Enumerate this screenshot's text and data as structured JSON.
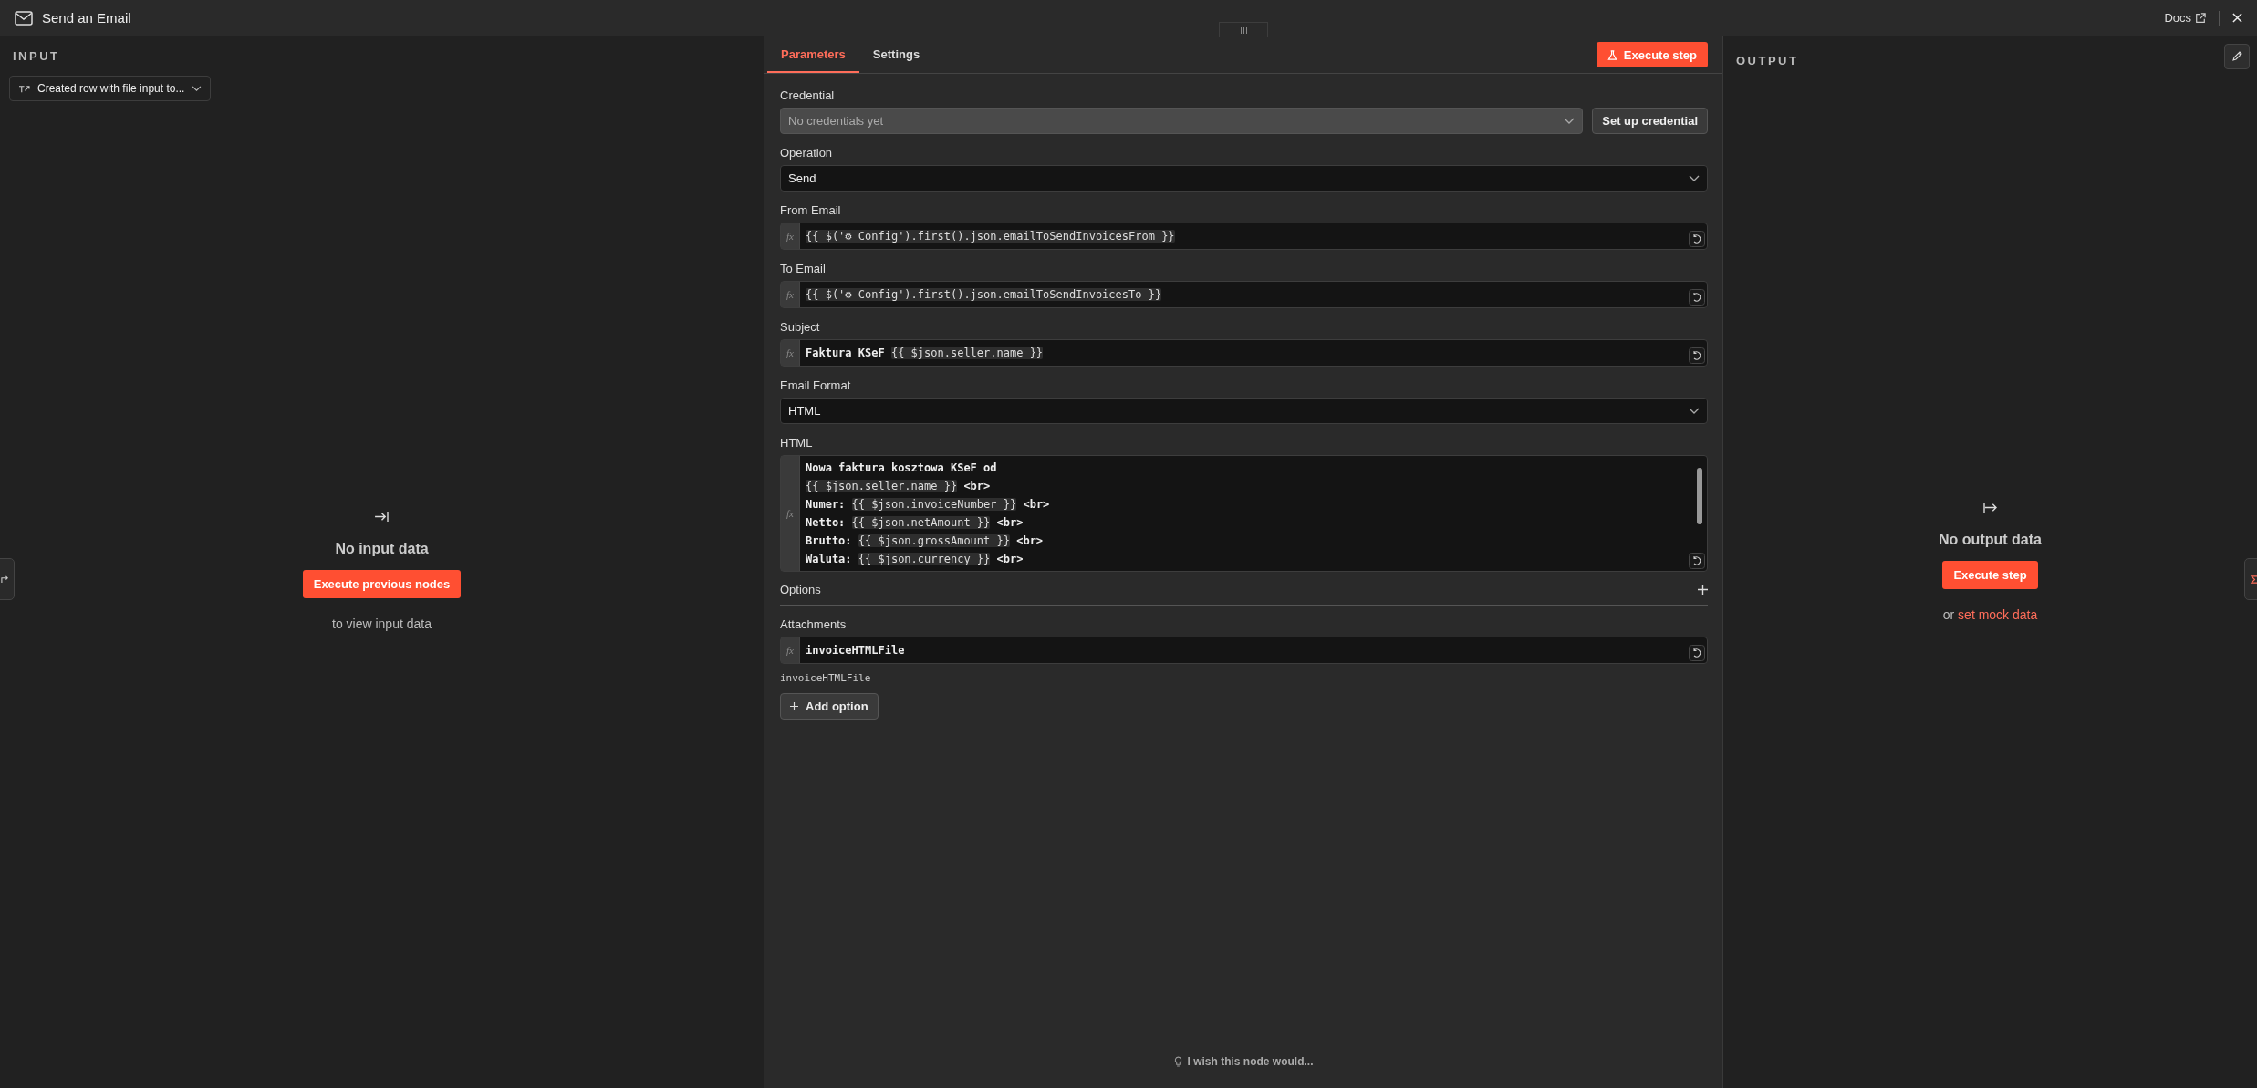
{
  "header": {
    "title": "Send an Email",
    "docs_link": "Docs"
  },
  "input_panel": {
    "title": "INPUT",
    "source_select": "Created row with file input to...",
    "empty_title": "No input data",
    "button": "Execute previous nodes",
    "hint": "to view input data"
  },
  "tabs": [
    {
      "label": "Parameters",
      "selected": true
    },
    {
      "label": "Settings",
      "selected": false
    }
  ],
  "execute_button": "Execute step",
  "fields": [
    {
      "kind": "select",
      "label": "Credential",
      "placeholder": "No credentials yet",
      "disabled": true,
      "action": "Set up credential"
    },
    {
      "kind": "select",
      "label": "Operation",
      "value": "Send",
      "disabled": false
    },
    {
      "kind": "expression",
      "label": "From Email",
      "badge": "fx",
      "segments": [
        {
          "highlighted": true,
          "text": "{{ $('⚙ Config').first().json.emailToSendInvoicesFrom }}"
        }
      ]
    },
    {
      "kind": "expression",
      "label": "To Email",
      "badge": "fx",
      "segments": [
        {
          "highlighted": true,
          "text": "{{ $('⚙ Config').first().json.emailToSendInvoicesTo }}"
        }
      ]
    },
    {
      "kind": "expression",
      "label": "Subject",
      "badge": "fx",
      "segments": [
        {
          "highlighted": false,
          "text": "Faktura KSeF "
        },
        {
          "highlighted": true,
          "text": "{{ $json.seller.name }}"
        }
      ]
    },
    {
      "kind": "select",
      "label": "Email Format",
      "value": "HTML",
      "disabled": false
    },
    {
      "kind": "code",
      "label": "HTML",
      "badge": "fx",
      "lines": [
        [
          {
            "highlighted": false,
            "text": "Nowa faktura kosztowa KSeF od"
          }
        ],
        [
          {
            "highlighted": true,
            "text": "{{ $json.seller.name }}"
          },
          {
            "highlighted": false,
            "text": " <br>"
          }
        ],
        [
          {
            "highlighted": false,
            "text": "Numer: "
          },
          {
            "highlighted": true,
            "text": "{{ $json.invoiceNumber }}"
          },
          {
            "highlighted": false,
            "text": " <br>"
          }
        ],
        [
          {
            "highlighted": false,
            "text": "Netto: "
          },
          {
            "highlighted": true,
            "text": "{{ $json.netAmount }}"
          },
          {
            "highlighted": false,
            "text": " <br>"
          }
        ],
        [
          {
            "highlighted": false,
            "text": "Brutto: "
          },
          {
            "highlighted": true,
            "text": "{{ $json.grossAmount }}"
          },
          {
            "highlighted": false,
            "text": " <br>"
          }
        ],
        [
          {
            "highlighted": false,
            "text": "Waluta: "
          },
          {
            "highlighted": true,
            "text": "{{ $json.currency }}"
          },
          {
            "highlighted": false,
            "text": " <br>"
          }
        ]
      ]
    },
    {
      "kind": "collection",
      "label": "Options"
    },
    {
      "kind": "expression",
      "label": "Attachments",
      "badge": "fx",
      "segments": [
        {
          "highlighted": false,
          "text": "invoiceHTMLFile"
        }
      ],
      "result": "invoiceHTMLFile"
    }
  ],
  "add_option": "Add option",
  "feedback": "I wish this node would...",
  "output_panel": {
    "title": "OUTPUT",
    "empty_title": "No output data",
    "button": "Execute step",
    "hint_prefix": "or",
    "hint_link": "set mock data"
  }
}
